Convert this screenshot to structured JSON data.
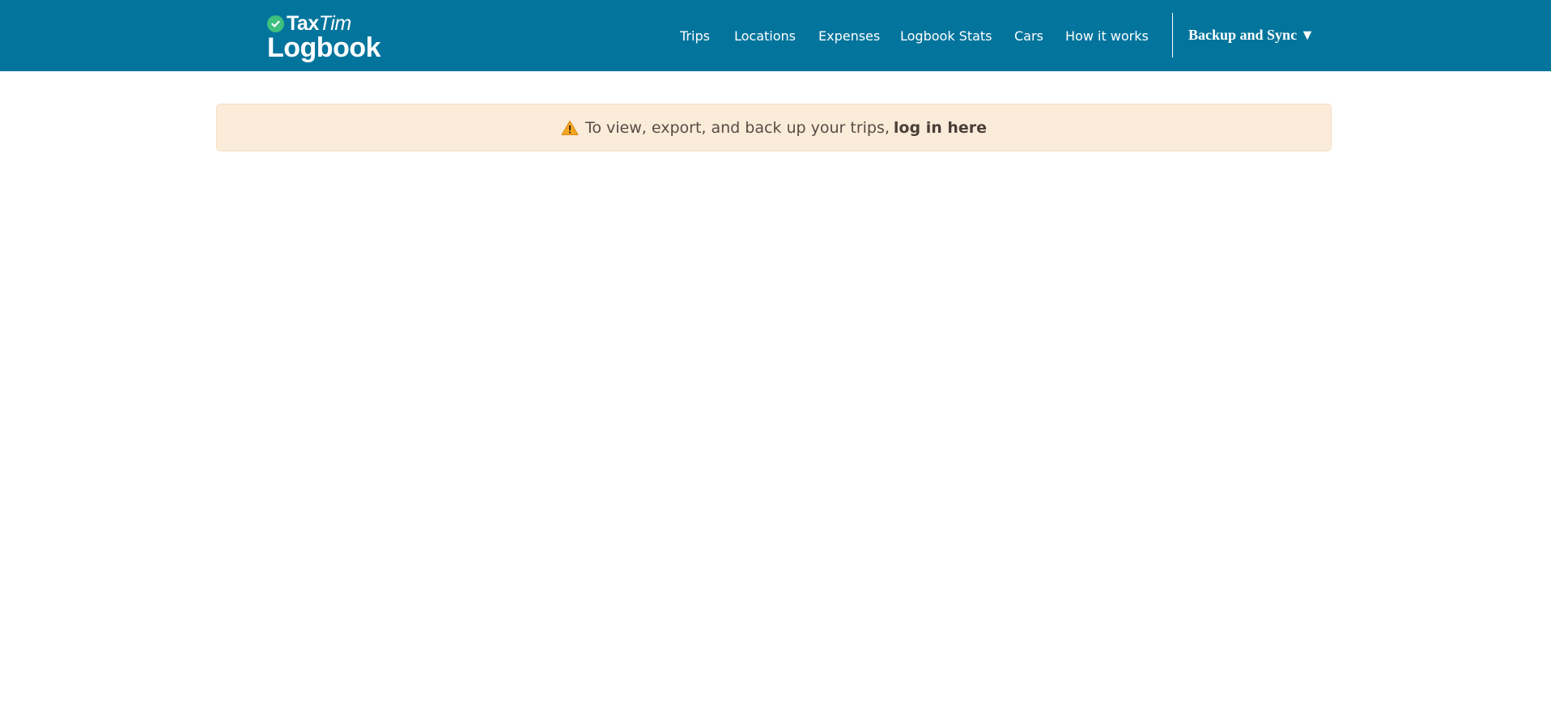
{
  "brand": {
    "name_prefix": "Tax",
    "name_suffix": "Tim",
    "product": "Logbook"
  },
  "nav": {
    "items": [
      {
        "label": "Trips"
      },
      {
        "label": "Locations"
      },
      {
        "label": "Expenses"
      },
      {
        "label": "Logbook Stats"
      },
      {
        "label": "Cars"
      },
      {
        "label": "How it works"
      }
    ],
    "sync_label": "Backup and Sync",
    "sync_caret": "▼"
  },
  "alert": {
    "text": "To view, export, and back up your trips,",
    "link": "log in here",
    "icon": "warning-icon"
  },
  "colors": {
    "header_bg": "#03759d",
    "check_green": "#3fc07e",
    "alert_bg": "#fbebd9",
    "warning": "#f4a623"
  }
}
